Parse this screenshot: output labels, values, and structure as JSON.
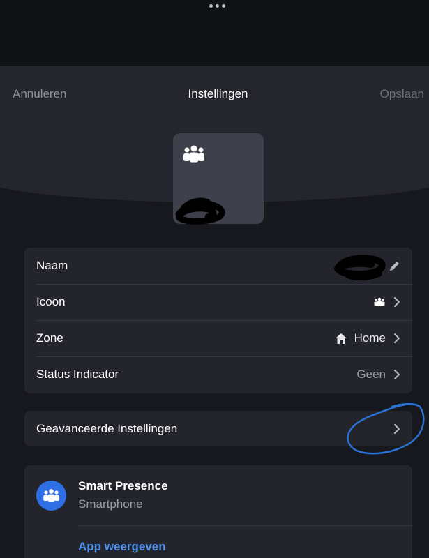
{
  "nav": {
    "cancel_label": "Annuleren",
    "title": "Instellingen",
    "save_label": "Opslaan"
  },
  "settings": {
    "name": {
      "label": "Naam",
      "icon": "pencil-icon"
    },
    "icon": {
      "label": "Icoon",
      "icon": "people-group-icon"
    },
    "zone": {
      "label": "Zone",
      "value": "Home",
      "icon": "home-icon"
    },
    "status": {
      "label": "Status Indicator",
      "value": "Geen"
    }
  },
  "advanced": {
    "label": "Geavanceerde Instellingen"
  },
  "presence": {
    "title": "Smart Presence",
    "subtitle": "Smartphone",
    "link_label": "App weergeven",
    "avatar_color": "#2f6fe6"
  },
  "colors": {
    "background": "#17181d",
    "card": "#24252c",
    "link": "#4b93f0",
    "annotation": "#2a72d6"
  }
}
